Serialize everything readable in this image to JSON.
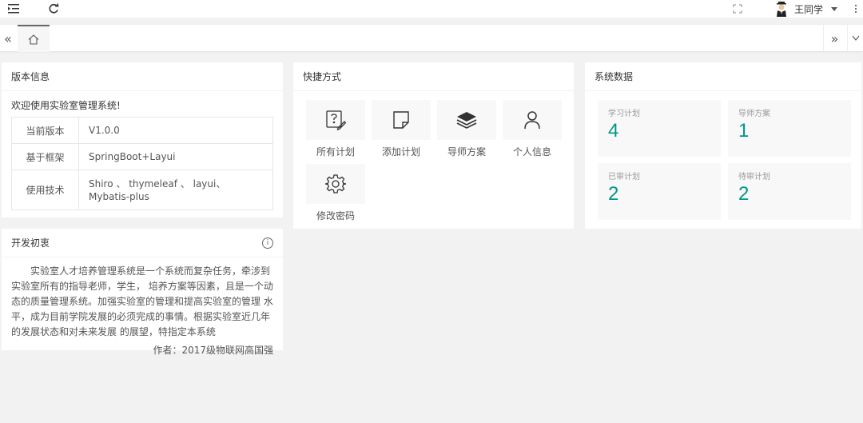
{
  "header": {
    "menu_icon": "menu-fold-icon",
    "refresh_icon": "refresh-icon",
    "fullscreen_icon": "fullscreen-icon",
    "user_name": "王同学",
    "more_icon": "more-vertical-icon"
  },
  "tabs": {
    "left_nav_icon": "double-chevron-left-icon",
    "home_icon": "home-icon",
    "right_nav_icon": "double-chevron-right-icon",
    "down_icon": "chevron-down-icon",
    "left_glyph": "«",
    "right_glyph": "»"
  },
  "version_card": {
    "title": "版本信息",
    "welcome": "欢迎使用实验室管理系统!",
    "rows": [
      {
        "key": "当前版本",
        "value": "V1.0.0"
      },
      {
        "key": "基于框架",
        "value": "SpringBoot+Layui"
      },
      {
        "key": "使用技术",
        "value": "Shiro 、 thymeleaf 、 layui、Mybatis-plus"
      }
    ]
  },
  "dev_card": {
    "title": "开发初衷",
    "text": "实验室人才培养管理系统是一个系统而复杂任务，牵涉到实验室所有的指导老师，学生， 培养方案等因素，且是一个动态的质量管理系统。加强实验室的管理和提高实验室的管理 水平，成为目前学院发展的必须完成的事情。根据实验室近几年的发展状态和对未来发展 的展望，特指定本系统",
    "author": "作者：2017级物联网高国强"
  },
  "shortcut_card": {
    "title": "快捷方式",
    "items": [
      {
        "label": "所有计划",
        "icon": "edit-note-icon"
      },
      {
        "label": "添加计划",
        "icon": "add-file-icon"
      },
      {
        "label": "导师方案",
        "icon": "layers-icon"
      },
      {
        "label": "个人信息",
        "icon": "user-icon"
      },
      {
        "label": "修改密码",
        "icon": "gear-icon"
      }
    ]
  },
  "stats_card": {
    "title": "系统数据",
    "items": [
      {
        "label": "学习计划",
        "value": "4"
      },
      {
        "label": "导师方案",
        "value": "1"
      },
      {
        "label": "已审计划",
        "value": "2"
      },
      {
        "label": "待审计划",
        "value": "2"
      }
    ]
  },
  "colors": {
    "accent": "#009688",
    "background": "#f2f2f2",
    "card": "#ffffff"
  }
}
